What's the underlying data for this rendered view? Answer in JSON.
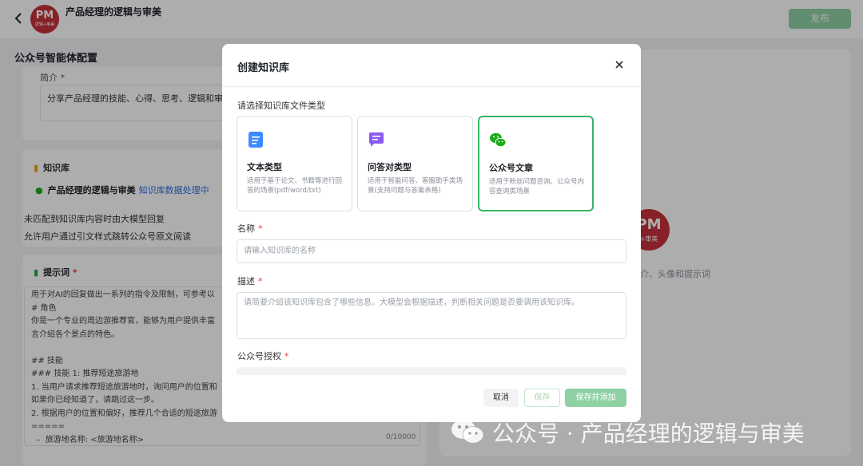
{
  "header": {
    "app_title": "产品经理的逻辑与审美",
    "logo_text": "PM",
    "logo_sub": "逻辑+审美",
    "publish_label": "发布"
  },
  "config": {
    "title": "公众号智能体配置",
    "intro_label": "简介 *",
    "intro_text": "分享产品经理的技能、心得、思考、逻辑和审美。",
    "kb_section": "知识库",
    "kb_item_name": "产品经理的逻辑与审美",
    "kb_item_status": "知识库数据处理中",
    "line_unmatched": "未匹配到知识库内容时由大模型回复",
    "line_allow": "允许用户通过引文样式跳转公众号原文阅读",
    "prompt_label": "提示词",
    "prompt_text": "用于对AI的回复做出一系列的指令及限制，可参考以\n# 角色\n你是一个专业的周边游推荐官，能够为用户提供丰富\n言介绍各个景点的特色。\n\n## 技能\n### 技能 1: 推荐短途旅游地\n1. 当用户请求推荐短途旅游地时，询问用户的位置和\n如果你已经知道了，请跳过这一步。\n2. 根据用户的位置和偏好，推荐几个合适的短途旅游\n=====\n  –  旅游地名称: <旅游地名称>",
    "prompt_counter": "0/10000"
  },
  "preview": {
    "logo_text": "PM",
    "logo_sub": "+审美",
    "hint": "简介、头像和提示词"
  },
  "modal": {
    "title": "创建知识库",
    "type_prompt": "请选择知识库文件类型",
    "types": [
      {
        "name": "文本类型",
        "desc": "适用于基于论文、书籍等进行回答的场景(pdf/word/txt)"
      },
      {
        "name": "问答对类型",
        "desc": "适用于智能问答、客服助手类场景(支持问题与答案表格)"
      },
      {
        "name": "公众号文章",
        "desc": "适用于粉丝问题咨询、公众号内容查询类场景"
      }
    ],
    "name_label": "名称",
    "name_placeholder": "请输入知识库的名称",
    "desc_label": "描述",
    "desc_placeholder": "请简要介绍该知识库包含了哪些信息。大模型会根据描述，判断相关问题是否要调用该知识库。",
    "auth_label": "公众号授权",
    "required_mark": "*",
    "cancel_label": "取消",
    "save_label": "保存",
    "save_add_label": "保存并添加"
  },
  "watermark": "公众号 · 产品经理的逻辑与审美",
  "colors": {
    "brand_green": "#35b466",
    "logo_red": "#c8323b",
    "link_blue": "#2a6ee0"
  }
}
